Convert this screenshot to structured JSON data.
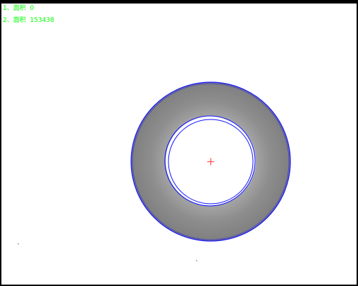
{
  "overlay": {
    "measurements": [
      {
        "index_label": "1、",
        "name": "面积",
        "value": "0"
      },
      {
        "index_label": "2、",
        "name": "面积",
        "value": "153438"
      }
    ],
    "text_color": "#00ff00"
  },
  "scene": {
    "washer_color": "#8f8f8f",
    "contour_color": "#1010ff",
    "center_marker_color": "#ff2a2a",
    "background_color": "#ffffff"
  }
}
